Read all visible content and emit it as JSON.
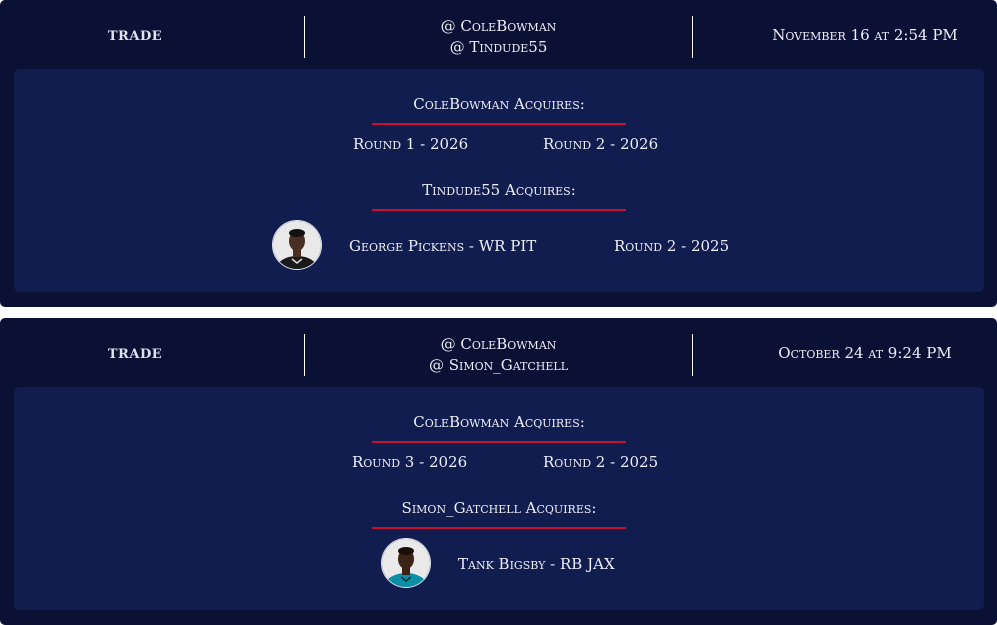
{
  "trades": [
    {
      "type": "trade",
      "participants": [
        "@ ColeBowman",
        "@ Tindude55"
      ],
      "date": "November 16 at 2:54 PM",
      "sides": [
        {
          "title": "ColeBowman Acquires:",
          "assets": [
            {
              "label": "Round 1 - 2026"
            },
            {
              "label": "Round 2 - 2026"
            }
          ]
        },
        {
          "title": "Tindude55 Acquires:",
          "assets": [
            {
              "label": "George Pickens - WR PIT",
              "avatar": "player-headshot-pickens"
            },
            {
              "label": "Round 2 - 2025"
            }
          ]
        }
      ]
    },
    {
      "type": "trade",
      "participants": [
        "@ ColeBowman",
        "@ Simon_Gatchell"
      ],
      "date": "October 24 at 9:24 PM",
      "sides": [
        {
          "title": "ColeBowman Acquires:",
          "assets": [
            {
              "label": "Round 3 - 2026"
            },
            {
              "label": "Round 2 - 2025"
            }
          ]
        },
        {
          "title": "Simon_Gatchell Acquires:",
          "assets": [
            {
              "label": "Tank Bigsby - RB JAX",
              "avatar": "player-headshot-bigsby"
            }
          ]
        }
      ]
    }
  ],
  "colors": {
    "card_bg": "#0b1035",
    "body_bg": "#111c4f",
    "accent_line": "#c8102e",
    "text": "#eef0f7",
    "jersey_pit": "#1a1a1a",
    "jersey_jax": "#0a8fa6"
  }
}
